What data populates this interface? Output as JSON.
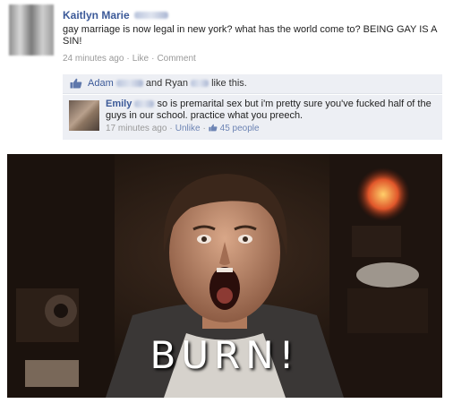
{
  "post": {
    "author_first": "Kaitlyn Marie",
    "text": "gay marriage is now legal in new york? what has the world come to? BEING GAY IS A SIN!",
    "time": "24 minutes ago",
    "like_label": "Like",
    "comment_label": "Comment"
  },
  "likes": {
    "name1": "Adam",
    "joiner": "and Ryan",
    "suffix": "like this."
  },
  "comment": {
    "author": "Emily",
    "text": "so is premarital sex but i'm pretty sure you've fucked half of the guys in our school. practice what you preech.",
    "time": "17 minutes ago",
    "unlike_label": "Unlike",
    "like_count": "45 people"
  },
  "image": {
    "caption": "BURN!"
  },
  "colors": {
    "link_blue": "#3b5998",
    "comment_bg": "#edeff4",
    "meta_gray": "#999999"
  },
  "icons": {
    "like": "thumbs-up-icon"
  }
}
